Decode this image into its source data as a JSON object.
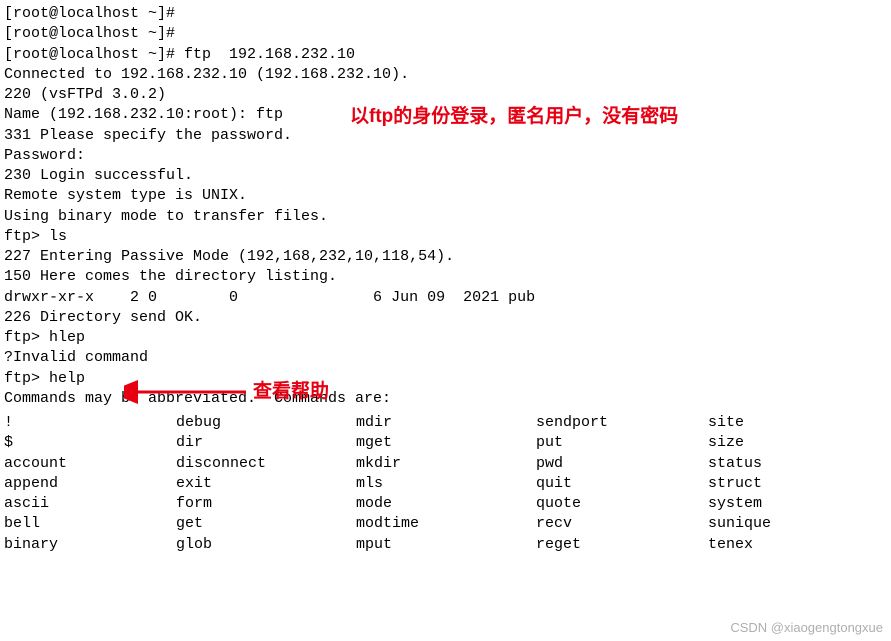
{
  "lines": {
    "l0": "[root@localhost ~]#",
    "l1": "[root@localhost ~]#",
    "l2": "[root@localhost ~]# ftp  192.168.232.10",
    "l3": "Connected to 192.168.232.10 (192.168.232.10).",
    "l4": "220 (vsFTPd 3.0.2)",
    "l5": "Name (192.168.232.10:root): ftp",
    "l6": "331 Please specify the password.",
    "l7": "Password:",
    "l8": "230 Login successful.",
    "l9": "Remote system type is UNIX.",
    "l10": "Using binary mode to transfer files.",
    "l11": "ftp> ls",
    "l12": "227 Entering Passive Mode (192,168,232,10,118,54).",
    "l13": "150 Here comes the directory listing.",
    "l14": "drwxr-xr-x    2 0        0               6 Jun 09  2021 pub",
    "l15": "226 Directory send OK.",
    "l16": "ftp> hlep",
    "l17": "?Invalid command",
    "l18": "ftp> help",
    "l19": "Commands may be abbreviated.  Commands are:",
    "l20": ""
  },
  "annotations": {
    "a1": "以ftp的身份登录，匿名用户，没有密码",
    "a2": "查看帮助"
  },
  "commands": {
    "rows": [
      [
        "!",
        "debug",
        "mdir",
        "sendport",
        "site"
      ],
      [
        "$",
        "dir",
        "mget",
        "put",
        "size"
      ],
      [
        "account",
        "disconnect",
        "mkdir",
        "pwd",
        "status"
      ],
      [
        "append",
        "exit",
        "mls",
        "quit",
        "struct"
      ],
      [
        "ascii",
        "form",
        "mode",
        "quote",
        "system"
      ],
      [
        "bell",
        "get",
        "modtime",
        "recv",
        "sunique"
      ],
      [
        "binary",
        "glob",
        "mput",
        "reget",
        "tenex"
      ]
    ]
  },
  "watermark": "CSDN @xiaogengtongxue"
}
